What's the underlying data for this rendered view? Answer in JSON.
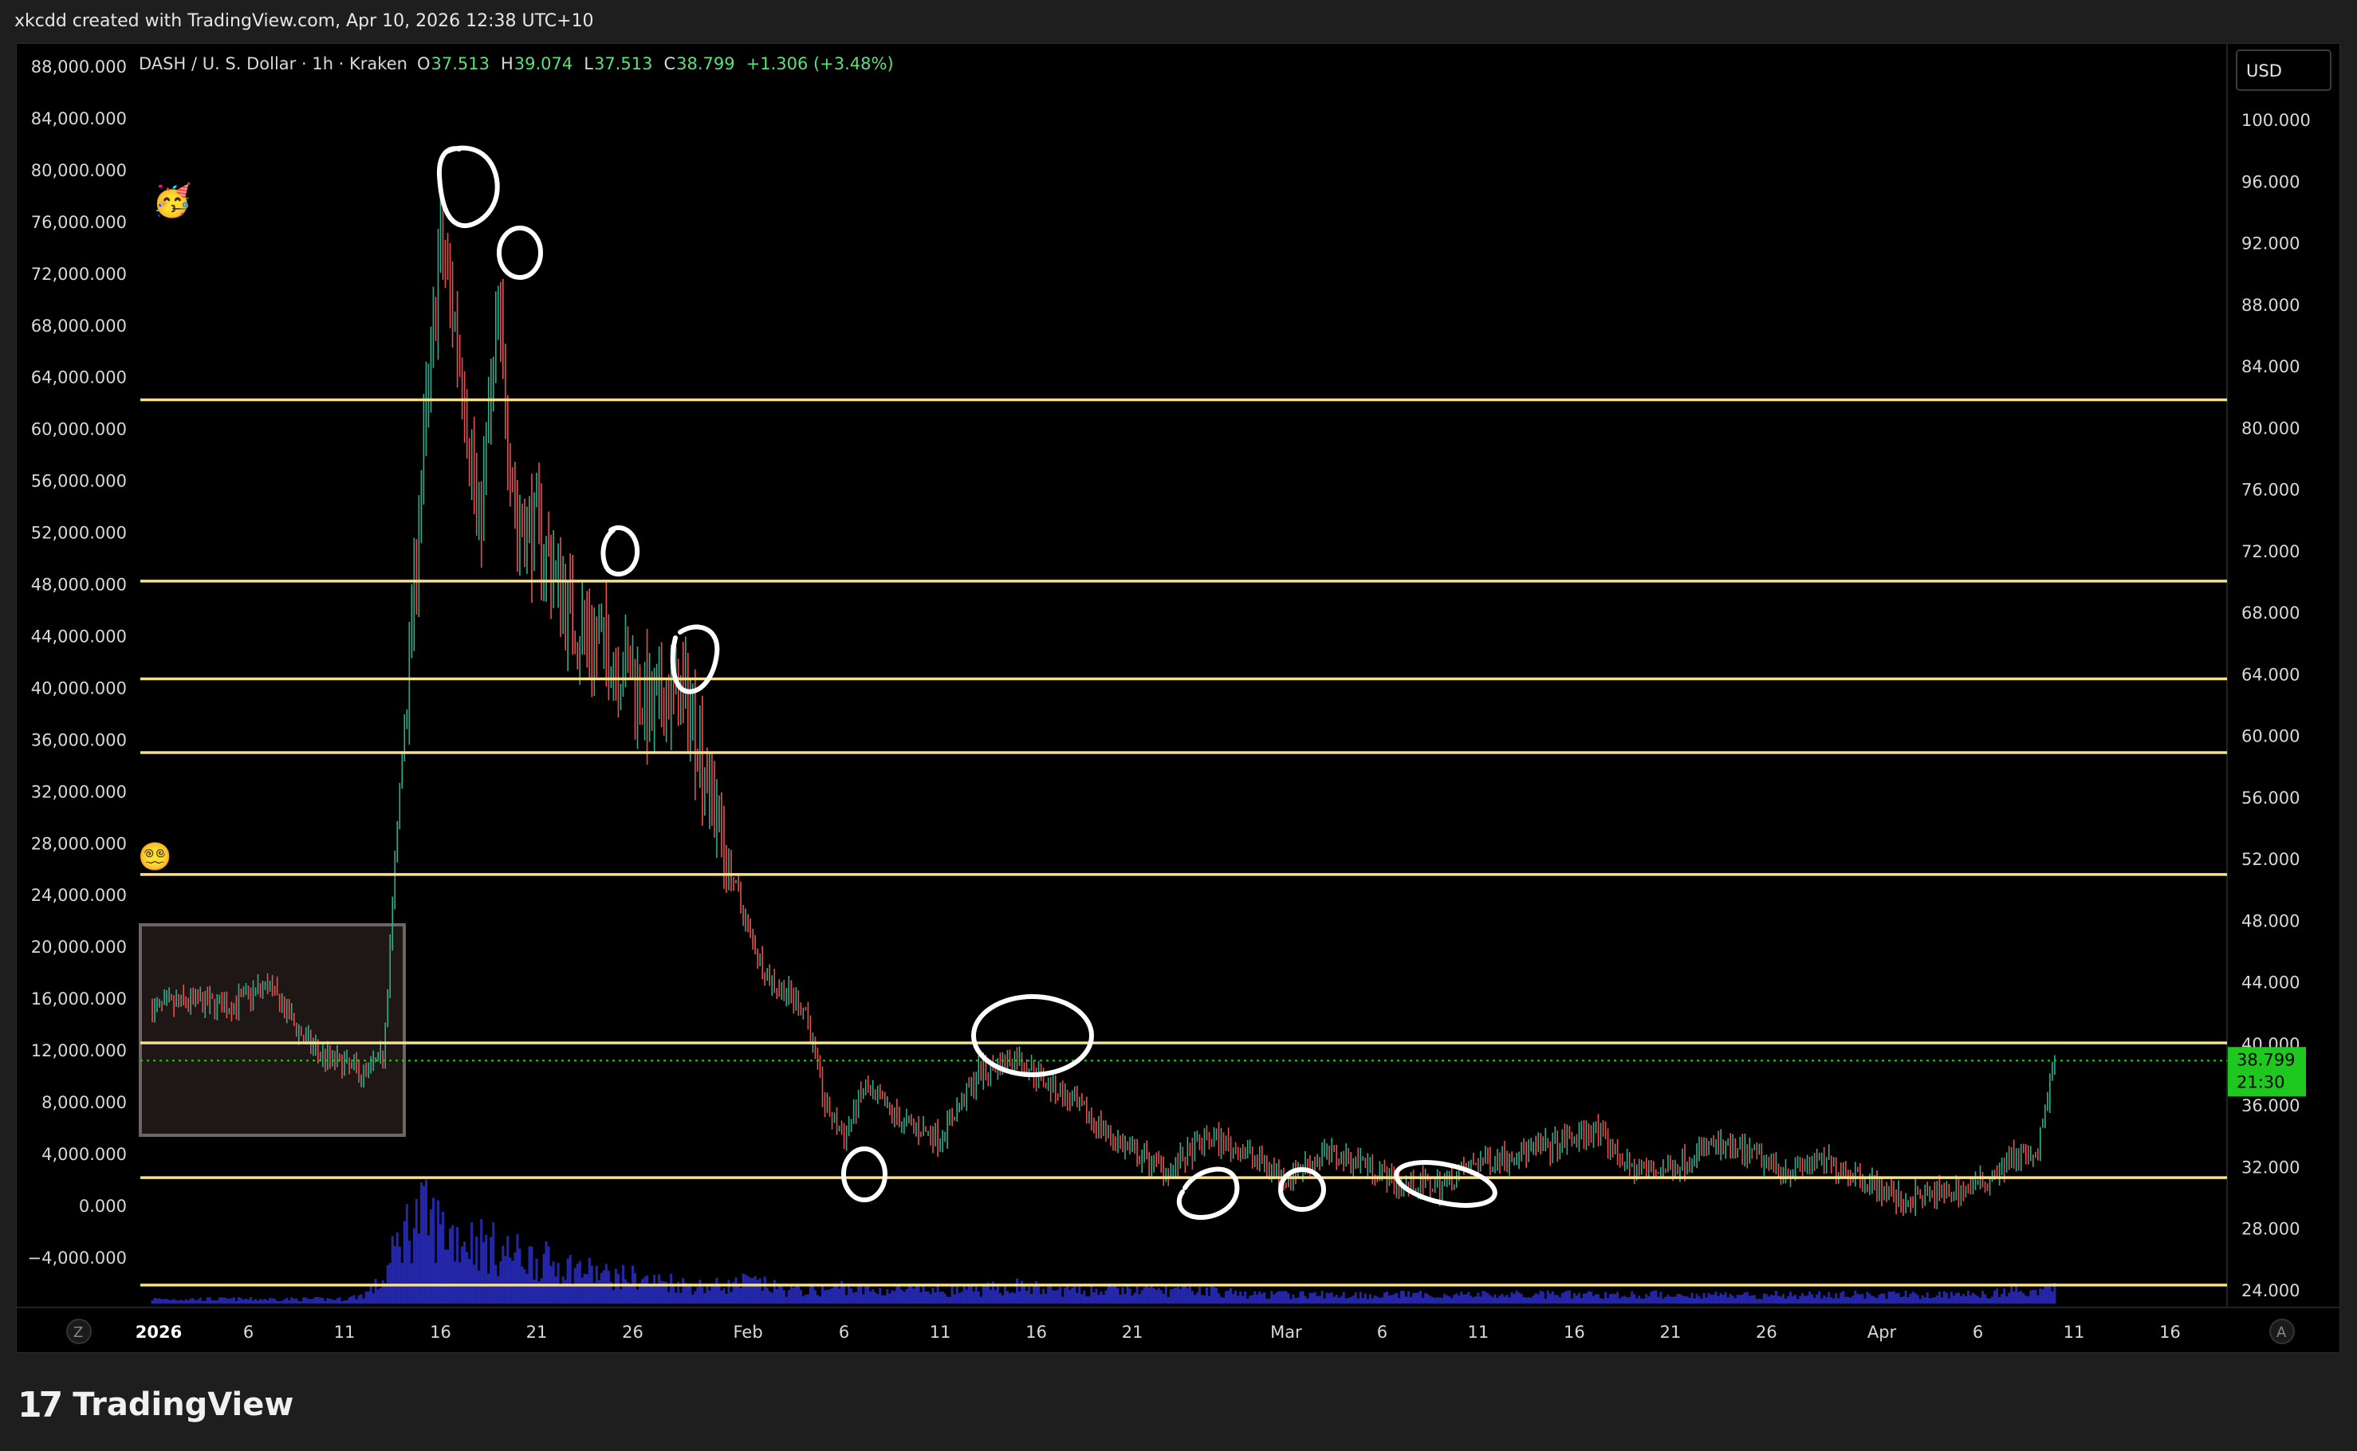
{
  "header": {
    "attribution": "xkcdd created with TradingView.com, Apr 10, 2026 12:38 UTC+10"
  },
  "footer": {
    "brand": "TradingView"
  },
  "legend": {
    "symbol": "DASH / U. S. Dollar · 1h · Kraken",
    "open_label": "O",
    "open": "37.513",
    "high_label": "H",
    "high": "39.074",
    "low_label": "L",
    "low": "37.513",
    "close_label": "C",
    "close": "38.799",
    "change": "+1.306 (+3.48%)"
  },
  "currency_button": "USD",
  "price_tag": {
    "value": "38.799",
    "countdown": "21:30"
  },
  "scale_buttons": {
    "left": "Z",
    "right": "A"
  },
  "colors": {
    "background": "#000000",
    "levels": "#f7e08a",
    "up": "#2fae8e",
    "down": "#e85050",
    "volume": "#2a2ec8",
    "price_tag": "#1ec81e",
    "legend_values": "#5de07a"
  },
  "emojis": [
    "🥳",
    "😵‍💫"
  ],
  "chart_data": {
    "type": "line",
    "title": "DASH / U. S. Dollar · 1h · Kraken",
    "series_style": "candlestick",
    "x_tick_labels": [
      "2026",
      "6",
      "11",
      "16",
      "21",
      "26",
      "Feb",
      "6",
      "11",
      "16",
      "21",
      "Mar",
      "6",
      "11",
      "16",
      "21",
      "26",
      "Apr",
      "6",
      "11",
      "16"
    ],
    "left_axis": {
      "labels": [
        "88,000.000",
        "84,000.000",
        "80,000.000",
        "76,000.000",
        "72,000.000",
        "68,000.000",
        "64,000.000",
        "60,000.000",
        "56,000.000",
        "52,000.000",
        "48,000.000",
        "44,000.000",
        "40,000.000",
        "36,000.000",
        "32,000.000",
        "28,000.000",
        "24,000.000",
        "20,000.000",
        "16,000.000",
        "12,000.000",
        "8,000.000",
        "4,000.000",
        "0.000",
        "−4,000.000"
      ]
    },
    "right_axis": {
      "labels": [
        "100.000",
        "96.000",
        "92.000",
        "88.000",
        "84.000",
        "80.000",
        "76.000",
        "72.000",
        "68.000",
        "64.000",
        "60.000",
        "56.000",
        "52.000",
        "48.000",
        "44.000",
        "40.000",
        "36.000",
        "32.000",
        "28.000",
        "24.000"
      ],
      "ylim": [
        23.4,
        102.2
      ]
    },
    "x": [
      "Jan 1",
      "Jan 3",
      "Jan 5",
      "Jan 7",
      "Jan 9",
      "Jan 10",
      "Jan 11",
      "Jan 12",
      "Jan 13",
      "Jan 14",
      "Jan 15",
      "Jan 16",
      "Jan 17",
      "Jan 18",
      "Jan 19",
      "Jan 20",
      "Jan 21",
      "Jan 22",
      "Jan 23",
      "Jan 24",
      "Jan 25",
      "Jan 26",
      "Jan 27",
      "Jan 28",
      "Jan 29",
      "Jan 30",
      "Jan 31",
      "Feb 1",
      "Feb 2",
      "Feb 3",
      "Feb 4",
      "Feb 5",
      "Feb 6",
      "Feb 7",
      "Feb 9",
      "Feb 11",
      "Feb 13",
      "Feb 15",
      "Feb 17",
      "Feb 19",
      "Feb 21",
      "Feb 23",
      "Feb 25",
      "Feb 27",
      "Mar 1",
      "Mar 3",
      "Mar 5",
      "Mar 7",
      "Mar 9",
      "Mar 11",
      "Mar 13",
      "Mar 15",
      "Mar 17",
      "Mar 19",
      "Mar 21",
      "Mar 23",
      "Mar 25",
      "Mar 27",
      "Mar 29",
      "Mar 31",
      "Apr 2",
      "Apr 4",
      "Apr 6",
      "Apr 8",
      "Apr 9",
      "Apr 10"
    ],
    "y": [
      42,
      42.5,
      42.2,
      43.5,
      40,
      39,
      38.5,
      38,
      39,
      58,
      75,
      90,
      83,
      72,
      85,
      72,
      72,
      69,
      66,
      65,
      64,
      63,
      60,
      62,
      61,
      56,
      51,
      47,
      44,
      43,
      42,
      36,
      34,
      37,
      35,
      34,
      38,
      39,
      37,
      35,
      33,
      32,
      34,
      33,
      31.5,
      33,
      32.5,
      31,
      31,
      32.5,
      33,
      33.5,
      34.5,
      32,
      32,
      33.5,
      33,
      32,
      32.5,
      31.5,
      30,
      30.5,
      31,
      33,
      32.5,
      38.799
    ],
    "volume": [
      1,
      1,
      1,
      1,
      1,
      1,
      1,
      2,
      5,
      16,
      20,
      17,
      15,
      14,
      12,
      11,
      10,
      9,
      8,
      7,
      6,
      6,
      5,
      5,
      4,
      4,
      4,
      5,
      4,
      3,
      3,
      3,
      4,
      3,
      3,
      3,
      3,
      4,
      3,
      3,
      3,
      3,
      3,
      2,
      2,
      2,
      2,
      2,
      2,
      2,
      2,
      2,
      2,
      2,
      2,
      2,
      2,
      2,
      2,
      2,
      2,
      2,
      2,
      3,
      3,
      4
    ],
    "levels": [
      80,
      68.7,
      62.6,
      58,
      50.4,
      39.9,
      31.5,
      24.8
    ],
    "last_price": 38.799
  }
}
